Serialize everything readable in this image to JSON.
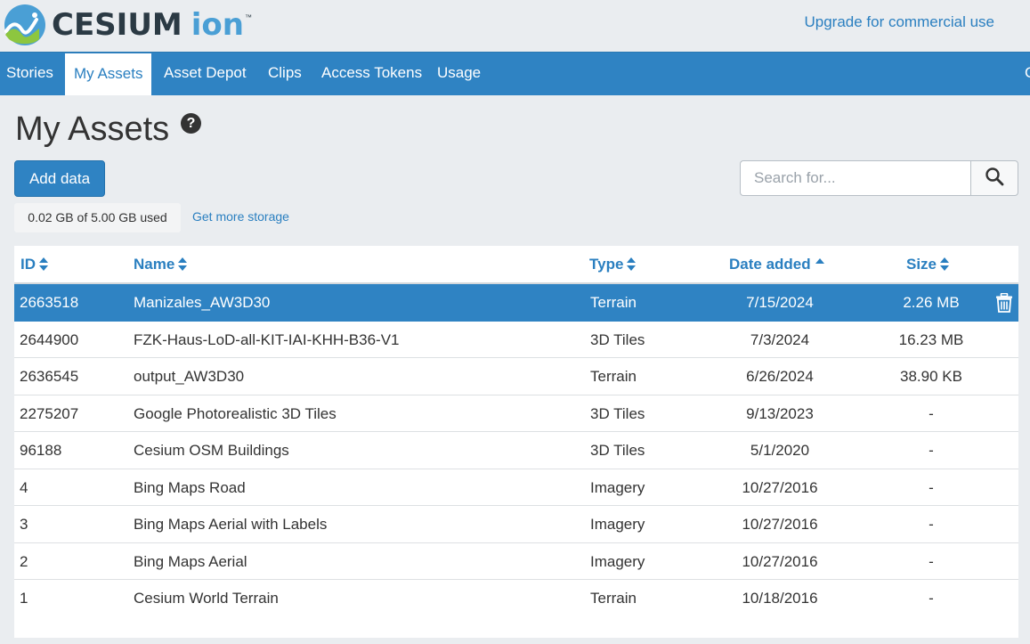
{
  "header": {
    "logo_word": "CESIUM",
    "logo_ion": "ion",
    "logo_tm": "™",
    "upgrade_link": "Upgrade for commercial use"
  },
  "nav": {
    "items": [
      {
        "label": "Stories",
        "active": false
      },
      {
        "label": "My Assets",
        "active": true
      },
      {
        "label": "Asset Depot",
        "active": false
      },
      {
        "label": "Clips",
        "active": false
      },
      {
        "label": "Access Tokens",
        "active": false
      },
      {
        "label": "Usage",
        "active": false
      }
    ],
    "clipped_item": "C"
  },
  "page": {
    "title": "My Assets",
    "help": "?",
    "add_button": "Add data",
    "storage_usage": "0.02 GB of 5.00 GB used",
    "more_storage": "Get more storage",
    "search_placeholder": "Search for..."
  },
  "table": {
    "columns": [
      {
        "label": "ID",
        "sort": "both"
      },
      {
        "label": "Name",
        "sort": "both"
      },
      {
        "label": "Type",
        "sort": "both"
      },
      {
        "label": "Date added",
        "sort": "asc"
      },
      {
        "label": "Size",
        "sort": "both"
      }
    ],
    "rows": [
      {
        "id": "2663518",
        "name": "Manizales_AW3D30",
        "type": "Terrain",
        "date": "7/15/2024",
        "size": "2.26 MB",
        "selected": true
      },
      {
        "id": "2644900",
        "name": "FZK-Haus-LoD-all-KIT-IAI-KHH-B36-V1",
        "type": "3D Tiles",
        "date": "7/3/2024",
        "size": "16.23 MB",
        "selected": false
      },
      {
        "id": "2636545",
        "name": "output_AW3D30",
        "type": "Terrain",
        "date": "6/26/2024",
        "size": "38.90 KB",
        "selected": false
      },
      {
        "id": "2275207",
        "name": "Google Photorealistic 3D Tiles",
        "type": "3D Tiles",
        "date": "9/13/2023",
        "size": "-",
        "selected": false
      },
      {
        "id": "96188",
        "name": "Cesium OSM Buildings",
        "type": "3D Tiles",
        "date": "5/1/2020",
        "size": "-",
        "selected": false
      },
      {
        "id": "4",
        "name": "Bing Maps Road",
        "type": "Imagery",
        "date": "10/27/2016",
        "size": "-",
        "selected": false
      },
      {
        "id": "3",
        "name": "Bing Maps Aerial with Labels",
        "type": "Imagery",
        "date": "10/27/2016",
        "size": "-",
        "selected": false
      },
      {
        "id": "2",
        "name": "Bing Maps Aerial",
        "type": "Imagery",
        "date": "10/27/2016",
        "size": "-",
        "selected": false
      },
      {
        "id": "1",
        "name": "Cesium World Terrain",
        "type": "Terrain",
        "date": "10/18/2016",
        "size": "-",
        "selected": false
      }
    ]
  },
  "colors": {
    "accent": "#2f83c3",
    "link": "#2a7fc0",
    "logo_dark": "#2b3a44",
    "logo_light": "#4a9fd5"
  },
  "icons": {
    "logo": "cesium-logo-icon",
    "help": "help-icon",
    "search": "search-icon",
    "delete": "trash-icon",
    "sort": "sort-icon"
  }
}
